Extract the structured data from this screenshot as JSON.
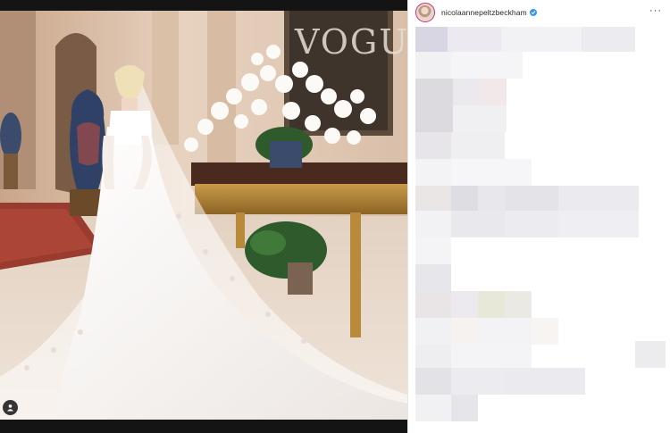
{
  "post": {
    "username": "nicolaannepeltzbeckham",
    "verified": true,
    "more_glyph": "···"
  },
  "photo": {
    "magazine_logo": "VOGUE",
    "tag_icon": "user-tag-icon"
  },
  "colors": {
    "verified_blue": "#3897f0",
    "avatar_ring": "#d62976"
  }
}
